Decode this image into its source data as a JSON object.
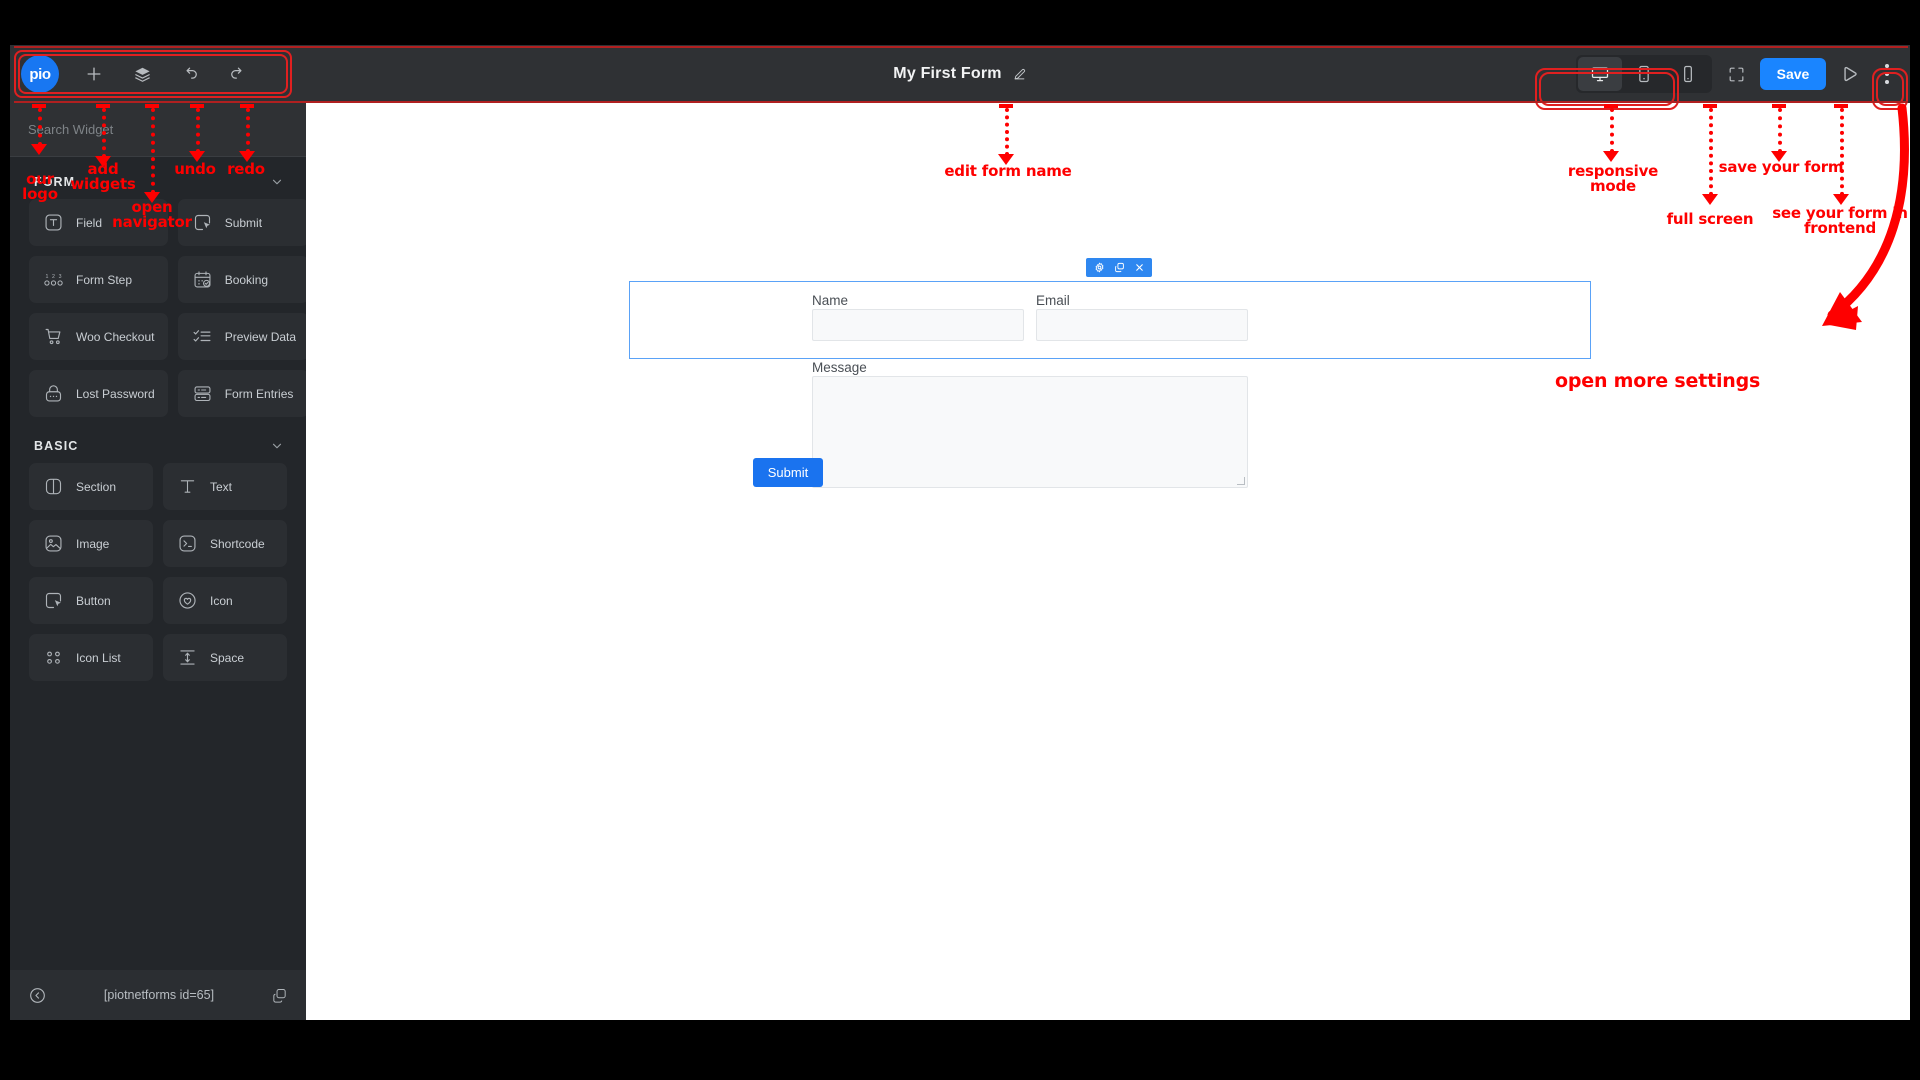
{
  "app": {
    "logo_text": "pio",
    "form_title": "My First Form"
  },
  "toolbar": {
    "add_icon": "plus-icon",
    "navigator_icon": "layers-icon",
    "undo_icon": "undo-icon",
    "redo_icon": "redo-icon",
    "edit_icon": "pencil-icon",
    "save_label": "Save",
    "responsive": [
      {
        "name": "desktop",
        "active": true
      },
      {
        "name": "tablet",
        "active": false
      },
      {
        "name": "mobile",
        "active": false
      }
    ],
    "fullscreen_icon": "fullscreen-icon",
    "preview_icon": "play-icon",
    "more_icon": "kebab-menu-icon"
  },
  "search": {
    "placeholder": "Search Widget"
  },
  "panel": {
    "categories": [
      {
        "title": "FORM",
        "widgets": [
          {
            "label": "Field",
            "icon": "field-icon"
          },
          {
            "label": "Submit",
            "icon": "submit-icon"
          },
          {
            "label": "Form Step",
            "icon": "form-step-icon"
          },
          {
            "label": "Booking",
            "icon": "booking-icon"
          },
          {
            "label": "Woo Checkout",
            "icon": "cart-icon"
          },
          {
            "label": "Preview Data",
            "icon": "checklist-icon"
          },
          {
            "label": "Lost Password",
            "icon": "lock-icon"
          },
          {
            "label": "Form Entries",
            "icon": "entries-icon"
          }
        ]
      },
      {
        "title": "BASIC",
        "widgets": [
          {
            "label": "Section",
            "icon": "section-icon"
          },
          {
            "label": "Text",
            "icon": "text-icon"
          },
          {
            "label": "Image",
            "icon": "image-icon"
          },
          {
            "label": "Shortcode",
            "icon": "shortcode-icon"
          },
          {
            "label": "Button",
            "icon": "button-icon"
          },
          {
            "label": "Icon",
            "icon": "heart-icon"
          },
          {
            "label": "Icon List",
            "icon": "icon-list-icon"
          },
          {
            "label": "Space",
            "icon": "space-icon"
          }
        ]
      }
    ]
  },
  "statusbar": {
    "collapse_icon": "collapse-left-icon",
    "shortcode": "[piotnetforms id=65]",
    "copy_icon": "copy-icon"
  },
  "form": {
    "section_toolbar": {
      "settings_icon": "gear-icon",
      "duplicate_icon": "duplicate-icon",
      "close_icon": "close-icon"
    },
    "fields": [
      {
        "label": "Name",
        "type": "text",
        "value": ""
      },
      {
        "label": "Email",
        "type": "text",
        "value": ""
      },
      {
        "label": "Message",
        "type": "textarea",
        "value": ""
      }
    ],
    "submit_label": "Submit"
  },
  "annotations": [
    {
      "id": "logo",
      "text": "our\nlogo"
    },
    {
      "id": "add",
      "text": "add\nwidgets"
    },
    {
      "id": "navigator",
      "text": "open\nnavigator"
    },
    {
      "id": "undo",
      "text": "undo"
    },
    {
      "id": "redo",
      "text": "redo"
    },
    {
      "id": "editname",
      "text": "edit form name"
    },
    {
      "id": "responsive",
      "text": "responsive mode"
    },
    {
      "id": "fullscreen",
      "text": "full screen"
    },
    {
      "id": "save",
      "text": "save your form"
    },
    {
      "id": "frontend",
      "text": "see your form in\nfrontend"
    },
    {
      "id": "more",
      "text": "open more settings"
    }
  ],
  "colors": {
    "accent_blue": "#1a85ff",
    "annotation_red": "#fe0000",
    "panel_bg": "#23262a",
    "topbar_bg": "#2f3134",
    "selection_blue": "#5aa2f7"
  }
}
